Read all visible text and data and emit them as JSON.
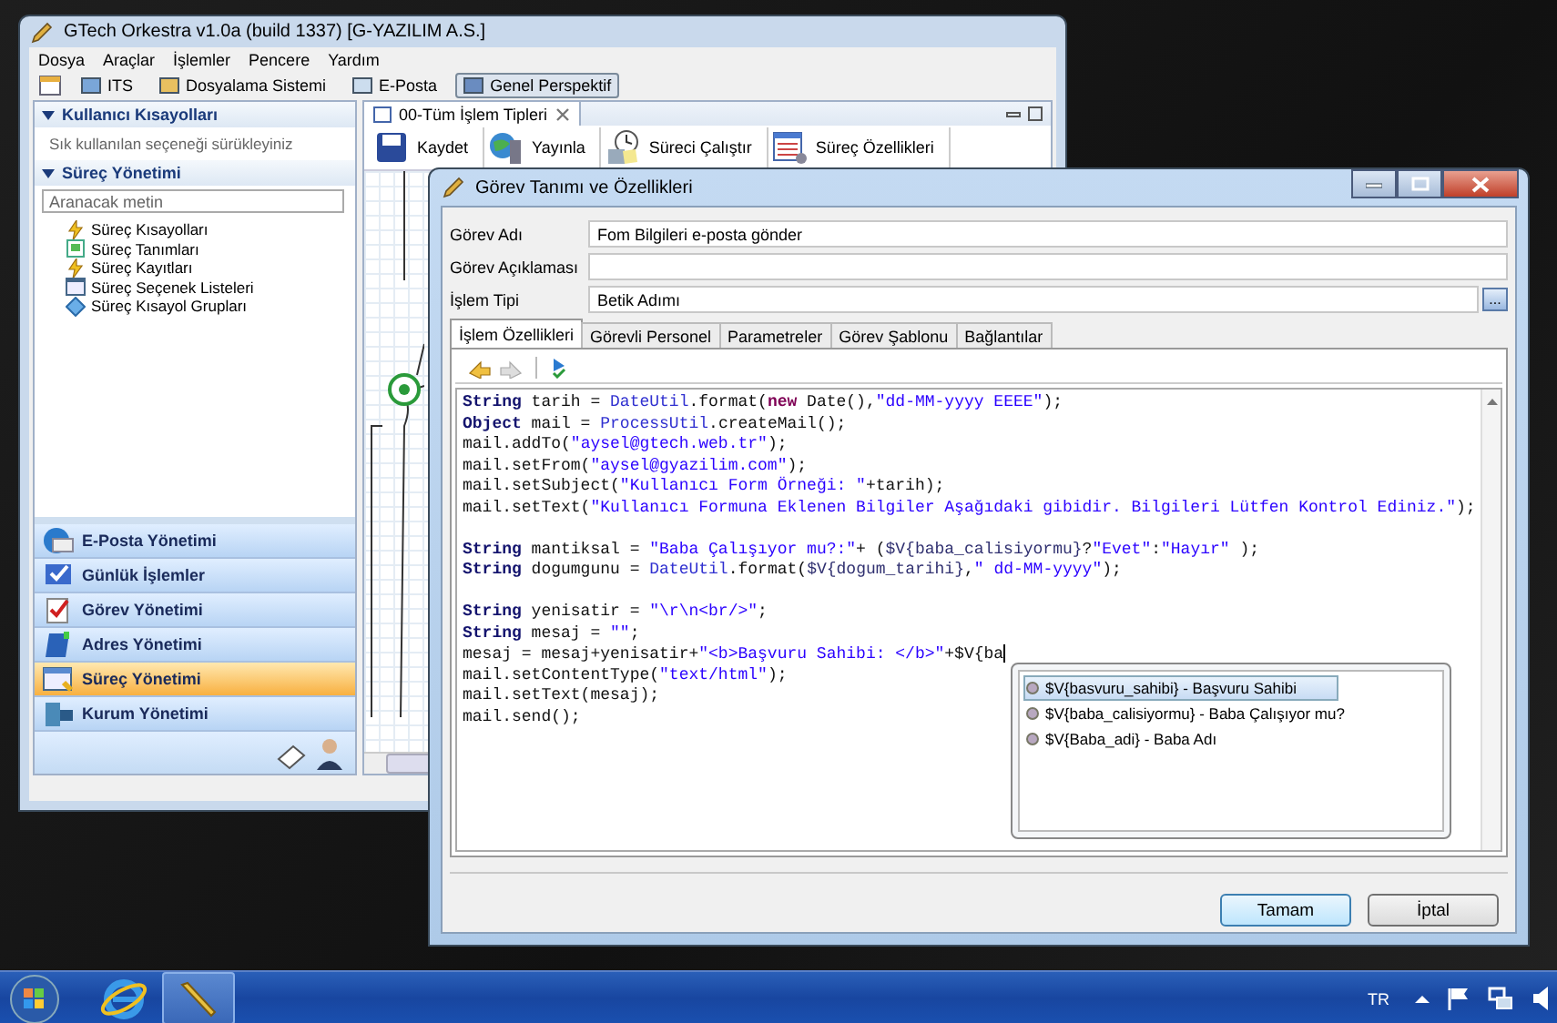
{
  "main_window": {
    "title": "GTech Orkestra v1.0a (build 1337) [G-YAZILIM A.S.]",
    "menu": [
      "Dosya",
      "Araçlar",
      "İşlemler",
      "Pencere",
      "Yardım"
    ],
    "perspectives": [
      {
        "label": "ITS",
        "selected": false
      },
      {
        "label": "Dosyalama Sistemi",
        "selected": false
      },
      {
        "label": "E-Posta",
        "selected": false
      },
      {
        "label": "Genel Perspektif",
        "selected": true
      }
    ],
    "sidebar": {
      "shortcuts": {
        "title": "Kullanıcı Kısayolları",
        "hint": "Sık kullanılan seçeneği sürükleyiniz"
      },
      "process": {
        "title": "Süreç Yönetimi",
        "search": {
          "placeholder": "Aranacak metin"
        },
        "items": [
          "Süreç Kısayolları",
          "Süreç Tanımları",
          "Süreç Kayıtları",
          "Süreç Seçenek Listeleri",
          "Süreç Kısayol Grupları"
        ]
      },
      "nav": [
        {
          "label": "E-Posta Yönetimi",
          "selected": false
        },
        {
          "label": "Günlük İşlemler",
          "selected": false
        },
        {
          "label": "Görev Yönetimi",
          "selected": false
        },
        {
          "label": "Adres Yönetimi",
          "selected": false
        },
        {
          "label": "Süreç Yönetimi",
          "selected": true
        },
        {
          "label": "Kurum Yönetimi",
          "selected": false
        }
      ]
    },
    "editor": {
      "tab": "00-Tüm İşlem Tipleri",
      "toolbar": [
        "Kaydet",
        "Yayınla",
        "Süreci Çalıştır",
        "Süreç Özellikleri"
      ]
    }
  },
  "dialog": {
    "title": "Görev Tanımı ve Özellikleri",
    "fields": [
      {
        "label": "Görev Adı",
        "value": "Fom Bilgileri e-posta gönder"
      },
      {
        "label": "Görev Açıklaması"
      },
      {
        "label": "İşlem Tipi",
        "value": "Betik Adımı",
        "browse": "..."
      }
    ],
    "tabs": [
      {
        "label": "İşlem Özellikleri",
        "selected": true
      },
      {
        "label": "Görevli Personel",
        "selected": false
      },
      {
        "label": "Parametreler",
        "selected": false
      },
      {
        "label": "Görev Şablonu",
        "selected": false
      },
      {
        "label": "Bağlantılar",
        "selected": false
      }
    ],
    "code_blocks": [
      [
        {
          "cursor": false,
          "tokens": [
            {
              "kind": "type",
              "t": "String"
            },
            {
              "kind": "plain",
              "t": " tarih = "
            },
            {
              "kind": "class",
              "t": "DateUtil"
            },
            {
              "kind": "plain",
              "t": ".format("
            },
            {
              "kind": "keyword",
              "t": "new"
            },
            {
              "kind": "plain",
              "t": " Date(),"
            },
            {
              "kind": "string",
              "t": "\"dd-MM-yyyy EEEE\""
            },
            {
              "kind": "plain",
              "t": ");"
            }
          ]
        },
        {
          "cursor": false,
          "tokens": [
            {
              "kind": "type",
              "t": "Object"
            },
            {
              "kind": "plain",
              "t": " mail = "
            },
            {
              "kind": "class",
              "t": "ProcessUtil"
            },
            {
              "kind": "plain",
              "t": ".createMail();"
            }
          ]
        },
        {
          "cursor": false,
          "tokens": [
            {
              "kind": "plain",
              "t": "mail.addTo("
            },
            {
              "kind": "string",
              "t": "\"aysel@gtech.web.tr\""
            },
            {
              "kind": "plain",
              "t": ");"
            }
          ]
        },
        {
          "cursor": false,
          "tokens": [
            {
              "kind": "plain",
              "t": "mail.setFrom("
            },
            {
              "kind": "string",
              "t": "\"aysel@gyazilim.com\""
            },
            {
              "kind": "plain",
              "t": ");"
            }
          ]
        },
        {
          "cursor": false,
          "tokens": [
            {
              "kind": "plain",
              "t": "mail.setSubject("
            },
            {
              "kind": "string",
              "t": "\"Kullanıcı Form Örneği: \""
            },
            {
              "kind": "plain",
              "t": "+tarih);"
            }
          ]
        },
        {
          "cursor": false,
          "tokens": [
            {
              "kind": "plain",
              "t": "mail.setText("
            },
            {
              "kind": "string",
              "t": "\"Kullanıcı Formuna Eklenen Bilgiler Aşağıdaki gibidir. Bilgileri Lütfen Kontrol Ediniz.\""
            },
            {
              "kind": "plain",
              "t": ");"
            }
          ]
        }
      ],
      [
        {
          "cursor": false,
          "tokens": [
            {
              "kind": "type",
              "t": "String"
            },
            {
              "kind": "plain",
              "t": " mantiksal = "
            },
            {
              "kind": "string",
              "t": "\"Baba Çalışıyor mu?:\""
            },
            {
              "kind": "plain",
              "t": "+ ("
            },
            {
              "kind": "var",
              "t": "$V{baba_calisiyormu}"
            },
            {
              "kind": "plain",
              "t": "?"
            },
            {
              "kind": "string",
              "t": "\"Evet\""
            },
            {
              "kind": "plain",
              "t": ":"
            },
            {
              "kind": "string",
              "t": "\"Hayır\""
            },
            {
              "kind": "plain",
              "t": " );"
            }
          ]
        },
        {
          "cursor": false,
          "tokens": [
            {
              "kind": "type",
              "t": "String"
            },
            {
              "kind": "plain",
              "t": " dogumgunu = "
            },
            {
              "kind": "class",
              "t": "DateUtil"
            },
            {
              "kind": "plain",
              "t": ".format("
            },
            {
              "kind": "var",
              "t": "$V{dogum_tarihi}"
            },
            {
              "kind": "plain",
              "t": ","
            },
            {
              "kind": "string",
              "t": "\" dd-MM-yyyy\""
            },
            {
              "kind": "plain",
              "t": ");"
            }
          ]
        }
      ],
      [
        {
          "cursor": false,
          "tokens": [
            {
              "kind": "type",
              "t": "String"
            },
            {
              "kind": "plain",
              "t": " yenisatir = "
            },
            {
              "kind": "string",
              "t": "\"\\r\\n<br/>\""
            },
            {
              "kind": "plain",
              "t": ";"
            }
          ]
        },
        {
          "cursor": false,
          "tokens": [
            {
              "kind": "type",
              "t": "String"
            },
            {
              "kind": "plain",
              "t": " mesaj = "
            },
            {
              "kind": "string",
              "t": "\"\""
            },
            {
              "kind": "plain",
              "t": ";"
            }
          ]
        },
        {
          "cursor": true,
          "tokens": [
            {
              "kind": "plain",
              "t": "mesaj = mesaj+yenisatir+"
            },
            {
              "kind": "string",
              "t": "\"<b>Başvuru Sahibi: </b>\""
            },
            {
              "kind": "plain",
              "t": "+$V{ba"
            }
          ]
        },
        {
          "cursor": false,
          "tokens": [
            {
              "kind": "plain",
              "t": "mail.setContentType("
            },
            {
              "kind": "string",
              "t": "\"text/html\""
            },
            {
              "kind": "plain",
              "t": ");"
            }
          ]
        },
        {
          "cursor": false,
          "tokens": [
            {
              "kind": "plain",
              "t": "mail.setText(mesaj);"
            }
          ]
        },
        {
          "cursor": false,
          "tokens": [
            {
              "kind": "plain",
              "t": "mail.send();"
            }
          ]
        }
      ]
    ],
    "suggestions": [
      {
        "label": "$V{basvuru_sahibi} - Başvuru Sahibi",
        "selected": true
      },
      {
        "label": "$V{baba_calisiyormu} - Baba Çalışıyor mu?",
        "selected": false
      },
      {
        "label": "$V{Baba_adi} - Baba Adı",
        "selected": false
      }
    ],
    "buttons": [
      "Tamam",
      "İptal"
    ]
  },
  "taskbar": {
    "language": "TR"
  }
}
